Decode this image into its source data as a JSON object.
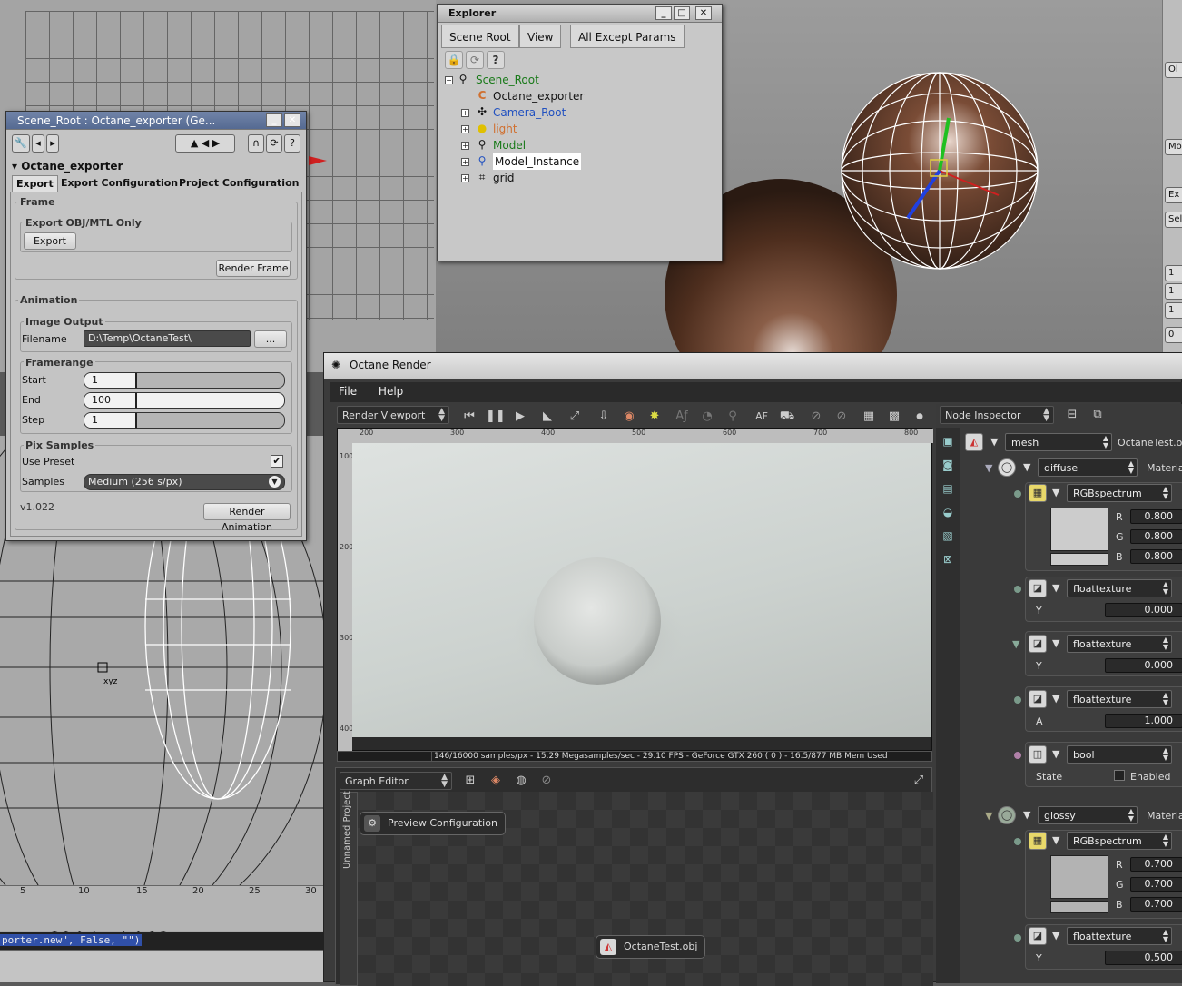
{
  "explorer": {
    "title": "Explorer",
    "menu": [
      "Scene Root",
      "View",
      "All Except Params"
    ],
    "tree": [
      {
        "label": "Scene_Root",
        "color": "#1a7a1a"
      },
      {
        "label": "Octane_exporter",
        "color": "#111111"
      },
      {
        "label": "Camera_Root",
        "color": "#2050c0"
      },
      {
        "label": "light",
        "color": "#d07030"
      },
      {
        "label": "Model",
        "color": "#1a7a1a"
      },
      {
        "label": "Model_Instance",
        "color": "#111111"
      },
      {
        "label": "grid",
        "color": "#111111"
      }
    ]
  },
  "ppg": {
    "title": "Scene_Root : Octane_exporter (Ge...",
    "object": "Octane_exporter",
    "tabs": [
      "Export",
      "Export Configuration",
      "Project Configuration"
    ],
    "frame_section": "Frame",
    "obj_group": "Export OBJ/MTL Only",
    "export_btn": "Export",
    "render_frame_btn": "Render Frame",
    "animation_section": "Animation",
    "image_output": "Image Output",
    "filename_label": "Filename",
    "filename_value": "D:\\Temp\\OctaneTest\\",
    "browse_btn": "...",
    "framerange": "Framerange",
    "start_label": "Start",
    "start_value": "1",
    "end_label": "End",
    "end_value": "100",
    "step_label": "Step",
    "step_value": "1",
    "pix_samples": "Pix Samples",
    "use_preset_label": "Use Preset",
    "samples_label": "Samples",
    "samples_value": "Medium (256 s/px)",
    "version": "v1.022",
    "render_anim_btn": "Render Animation"
  },
  "viewport": {
    "cursor_label": "xyz",
    "ruler_ticks": [
      "5",
      "10",
      "15",
      "20",
      "25",
      "30"
    ],
    "command_line": "porter.new\", False, \"\")",
    "right_strip": [
      "Ol",
      "Mo",
      "Ex",
      "Sel",
      "1",
      "1",
      "1",
      "0"
    ]
  },
  "octane": {
    "title": "Octane Render",
    "menu": [
      "File",
      "Help"
    ],
    "viewport_drop": "Render Viewport",
    "af_label": "AF",
    "hruler": [
      "200",
      "300",
      "400",
      "500",
      "600",
      "700",
      "800"
    ],
    "vruler": [
      "100",
      "200",
      "300",
      "400"
    ],
    "status": "146/16000 samples/px - 15.29 Megasamples/sec - 29.10 FPS - GeForce GTX 260 ( 0 ) - 16.5/877 MB Mem Used",
    "graph_drop": "Graph Editor",
    "graph_side": "Unnamed Project",
    "node_preview": "Preview Configuration",
    "node_obj": "OctaneTest.obj",
    "inspector_drop": "Node Inspector"
  },
  "inspector": {
    "mesh_drop": "mesh",
    "mesh_name": "OctaneTest.obj",
    "diffuse_drop": "diffuse",
    "material_label": "Materia",
    "rgb1": {
      "drop": "RGBspectrum",
      "r": "0.800",
      "g": "0.800",
      "b": "0.800"
    },
    "float1": {
      "drop": "floattexture",
      "label": "Y",
      "value": "0.000"
    },
    "float2": {
      "drop": "floattexture",
      "label": "Y",
      "value": "0.000"
    },
    "float3": {
      "drop": "floattexture",
      "label": "A",
      "value": "1.000"
    },
    "bool": {
      "drop": "bool",
      "label": "State",
      "check_label": "Enabled"
    },
    "glossy_drop": "glossy",
    "material_label2": "Materia",
    "rgb2": {
      "drop": "RGBspectrum",
      "r": "0.700",
      "g": "0.700",
      "b": "0.700"
    },
    "float4": {
      "drop": "floattexture",
      "label": "Y",
      "value": "0.500"
    },
    "r": "R",
    "g": "G",
    "b": "B"
  }
}
